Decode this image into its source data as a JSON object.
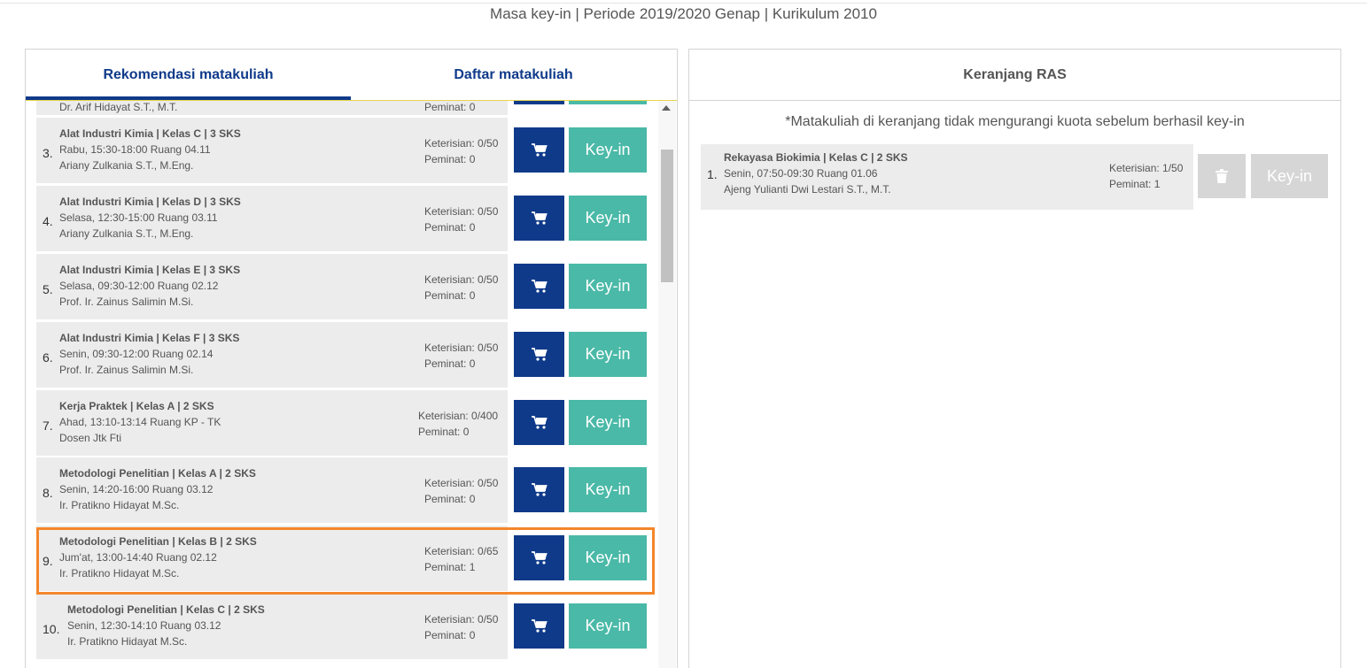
{
  "header": {
    "title": "Masa key-in | Periode 2019/2020 Genap | Kurikulum 2010"
  },
  "tabs": [
    {
      "label": "Rekomendasi matakuliah"
    },
    {
      "label": "Daftar matakuliah"
    }
  ],
  "partial_row": {
    "lecturer": "Dr. Arif Hidayat S.T., M.T.",
    "peminat": "Peminat: 0"
  },
  "courses": [
    {
      "num": "3.",
      "title": "Alat Industri Kimia | Kelas C | 3 SKS",
      "schedule": "Rabu, 15:30-18:00 Ruang 04.11",
      "lecturer": "Ariany Zulkania S.T., M.Eng.",
      "keterisian": "Keterisian: 0/50",
      "peminat": "Peminat: 0",
      "keyin_label": "Key-in"
    },
    {
      "num": "4.",
      "title": "Alat Industri Kimia | Kelas D | 3 SKS",
      "schedule": "Selasa, 12:30-15:00 Ruang 03.11",
      "lecturer": "Ariany Zulkania S.T., M.Eng.",
      "keterisian": "Keterisian: 0/50",
      "peminat": "Peminat: 0",
      "keyin_label": "Key-in"
    },
    {
      "num": "5.",
      "title": "Alat Industri Kimia | Kelas E | 3 SKS",
      "schedule": "Selasa, 09:30-12:00 Ruang 02.12",
      "lecturer": "Prof. Ir. Zainus Salimin M.Si.",
      "keterisian": "Keterisian: 0/50",
      "peminat": "Peminat: 0",
      "keyin_label": "Key-in"
    },
    {
      "num": "6.",
      "title": "Alat Industri Kimia | Kelas F | 3 SKS",
      "schedule": "Senin, 09:30-12:00 Ruang 02.14",
      "lecturer": "Prof. Ir. Zainus Salimin M.Si.",
      "keterisian": "Keterisian: 0/50",
      "peminat": "Peminat: 0",
      "keyin_label": "Key-in"
    },
    {
      "num": "7.",
      "title": "Kerja Praktek | Kelas A | 2 SKS",
      "schedule": "Ahad, 13:10-13:14 Ruang KP - TK",
      "lecturer": "Dosen Jtk Fti",
      "keterisian": "Keterisian: 0/400",
      "peminat": "Peminat: 0",
      "keyin_label": "Key-in"
    },
    {
      "num": "8.",
      "title": "Metodologi Penelitian | Kelas A | 2 SKS",
      "schedule": "Senin, 14:20-16:00 Ruang 03.12",
      "lecturer": "Ir. Pratikno Hidayat M.Sc.",
      "keterisian": "Keterisian: 0/50",
      "peminat": "Peminat: 0",
      "keyin_label": "Key-in"
    },
    {
      "num": "9.",
      "title": "Metodologi Penelitian | Kelas B | 2 SKS",
      "schedule": "Jum'at, 13:00-14:40 Ruang 02.12",
      "lecturer": "Ir. Pratikno Hidayat M.Sc.",
      "keterisian": "Keterisian: 0/65",
      "peminat": "Peminat: 1",
      "keyin_label": "Key-in"
    },
    {
      "num": "10.",
      "title": "Metodologi Penelitian | Kelas C | 2 SKS",
      "schedule": "Senin, 12:30-14:10 Ruang 03.12",
      "lecturer": "Ir. Pratikno Hidayat M.Sc.",
      "keterisian": "Keterisian: 0/50",
      "peminat": "Peminat: 0",
      "keyin_label": "Key-in"
    }
  ],
  "cart": {
    "title": "Keranjang RAS",
    "notice": "*Matakuliah di keranjang tidak mengurangi kuota sebelum berhasil key-in",
    "items": [
      {
        "num": "1.",
        "title": "Rekayasa Biokimia | Kelas C | 2 SKS",
        "schedule": "Senin, 07:50-09:30 Ruang 01.06",
        "lecturer": "Ajeng Yulianti Dwi Lestari S.T., M.T.",
        "keterisian": "Keterisian: 1/50",
        "peminat": "Peminat: 1",
        "keyin_label": "Key-in"
      }
    ]
  },
  "colors": {
    "primary": "#0f3a8a",
    "accent": "#4ab9a7",
    "highlight": "#f4862a"
  },
  "icons": {
    "cart": "shopping-cart-icon",
    "trash": "trash-icon"
  }
}
